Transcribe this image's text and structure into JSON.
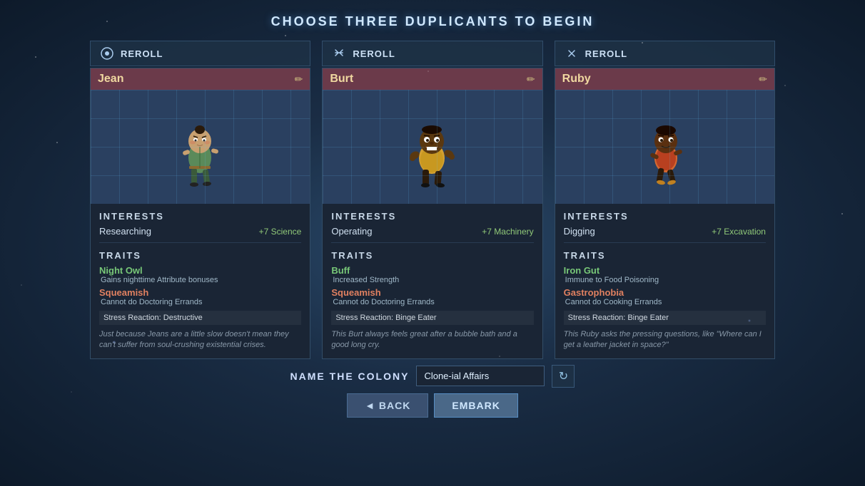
{
  "page": {
    "title": "CHOOSE THREE DUPLICANTS TO BEGIN"
  },
  "colony": {
    "label": "NAME THE COLONY",
    "name": "Clone-ial Affairs",
    "refresh_icon": "↻"
  },
  "buttons": {
    "back": "◄  BACK",
    "embark": "EMBARK",
    "reroll": "REROLL"
  },
  "duplicants": [
    {
      "id": "jean",
      "name": "Jean",
      "reroll_icon": "⊙",
      "interests_title": "INTERESTS",
      "interest_name": "Researching",
      "interest_bonus": "+7 Science",
      "traits_title": "TRAITS",
      "trait1_name": "Night Owl",
      "trait1_desc": "Gains nighttime Attribute bonuses",
      "trait1_type": "buff",
      "trait2_name": "Squeamish",
      "trait2_desc": "Cannot do Doctoring Errands",
      "trait2_type": "debuff",
      "stress_reaction": "Stress Reaction: Destructive",
      "flavor_text": "Just because Jeans are a little slow doesn't mean they can't suffer from soul-crushing existential crises."
    },
    {
      "id": "burt",
      "name": "Burt",
      "reroll_icon": "❊",
      "interests_title": "INTERESTS",
      "interest_name": "Operating",
      "interest_bonus": "+7 Machinery",
      "traits_title": "TRAITS",
      "trait1_name": "Buff",
      "trait1_desc": "Increased Strength",
      "trait1_type": "buff",
      "trait2_name": "Squeamish",
      "trait2_desc": "Cannot do Doctoring Errands",
      "trait2_type": "debuff",
      "stress_reaction": "Stress Reaction: Binge Eater",
      "flavor_text": "This Burt always feels great after a bubble bath and a good long cry."
    },
    {
      "id": "ruby",
      "name": "Ruby",
      "reroll_icon": "🔧",
      "interests_title": "INTERESTS",
      "interest_name": "Digging",
      "interest_bonus": "+7 Excavation",
      "traits_title": "TRAITS",
      "trait1_name": "Iron Gut",
      "trait1_desc": "Immune to Food Poisoning",
      "trait1_type": "buff",
      "trait2_name": "Gastrophobia",
      "trait2_desc": "Cannot do Cooking Errands",
      "trait2_type": "debuff",
      "stress_reaction": "Stress Reaction: Binge Eater",
      "flavor_text": "This Ruby asks the pressing questions, like \"Where can I get a leather jacket in space?\""
    }
  ]
}
